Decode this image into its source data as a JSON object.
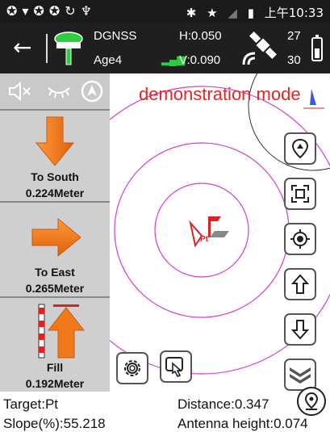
{
  "status_bar": {
    "left_icons": [
      "shield-icon",
      "wifi-question-icon",
      "shield-icon",
      "shield-icon",
      "sync-icon",
      "android-icon"
    ],
    "bluetooth": "bluetooth-icon",
    "star": "star-icon",
    "signal": "no-signal-icon",
    "battery_icon": "battery-charging-icon",
    "time": "上午10:33"
  },
  "header": {
    "mode": "DGNSS",
    "age": "Age4",
    "h_precision": "H:0.050",
    "v_precision": "V:0.090",
    "sat_top": "27",
    "sat_bottom": "30"
  },
  "map": {
    "demo_label": "demonstration mode",
    "point_label": "Pt"
  },
  "guidance": [
    {
      "label": "To South",
      "value": "0.224Meter"
    },
    {
      "label": "To East",
      "value": "0.265Meter"
    },
    {
      "label": "Fill",
      "value": "0.192Meter"
    }
  ],
  "footer": {
    "target": "Target:Pt",
    "distance": "Distance:0.347",
    "slope": "Slope(%):55.218",
    "antenna": "Antenna height:0.074"
  },
  "colors": {
    "arrow_orange": "#f07a1a",
    "circle_magenta": "#d63ad6",
    "demo_red": "#e02222",
    "panel_gray": "#cfcfcf"
  }
}
